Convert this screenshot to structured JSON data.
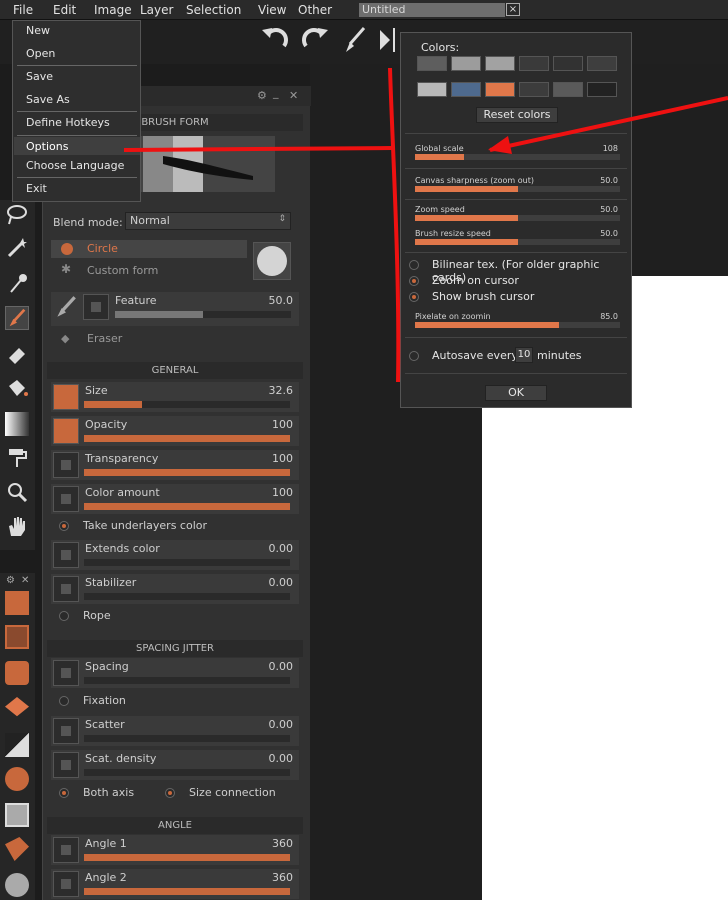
{
  "menubar": {
    "items": [
      "File",
      "Edit",
      "Image",
      "Layer",
      "Selection",
      "View",
      "Other"
    ],
    "document_title": "Untitled",
    "close_glyph": "×"
  },
  "file_menu": {
    "items": [
      "New",
      "Open",
      "Save",
      "Save As",
      "Define Hotkeys",
      "Options",
      "Choose Language",
      "Exit"
    ],
    "highlighted": "Options"
  },
  "brush_panel": {
    "brush_form_title": "BRUSH FORM",
    "blend_mode_label": "Blend mode:",
    "blend_mode_value": "Normal",
    "circle_label": "Circle",
    "custom_form_label": "Custom form",
    "feature": {
      "label": "Feature",
      "value": "50.0",
      "fraction": 0.5
    },
    "eraser_label": "Eraser",
    "general_title": "GENERAL",
    "general": [
      {
        "label": "Size",
        "value": "32.6",
        "fraction": 0.28
      },
      {
        "label": "Opacity",
        "value": "100",
        "fraction": 1.0
      },
      {
        "label": "Transparency",
        "value": "100",
        "fraction": 1.0
      },
      {
        "label": "Color amount",
        "value": "100",
        "fraction": 1.0
      }
    ],
    "take_underlayers": "Take underlayers color",
    "extends_color": {
      "label": "Extends color",
      "value": "0.00",
      "fraction": 0.0
    },
    "stabilizer": {
      "label": "Stabilizer",
      "value": "0.00",
      "fraction": 0.0
    },
    "rope_label": "Rope",
    "spacing_title": "SPACING JITTER",
    "spacing": {
      "label": "Spacing",
      "value": "0.00",
      "fraction": 0.0
    },
    "fixation_label": "Fixation",
    "scatter": {
      "label": "Scatter",
      "value": "0.00",
      "fraction": 0.0
    },
    "scat_density": {
      "label": "Scat. density",
      "value": "0.00",
      "fraction": 0.0
    },
    "both_axis_label": "Both axis",
    "size_connection_label": "Size connection",
    "angle_title": "ANGLE",
    "angle1": {
      "label": "Angle 1",
      "value": "360",
      "fraction": 1.0
    },
    "angle2": {
      "label": "Angle 2",
      "value": "360",
      "fraction": 1.0
    }
  },
  "options_dialog": {
    "colors_label": "Colors:",
    "swatch_colors_row1": [
      "#5e5e5e",
      "#9c9c9c",
      "#a2a2a2",
      "#3a3a3a",
      "#323232",
      "#3e3e3e"
    ],
    "swatch_colors_row2": [
      "#b8b8b8",
      "#4e6a8e",
      "#e0774a",
      "#3c3c3c",
      "#5a5a5a",
      "#222222"
    ],
    "reset_colors_label": "Reset colors",
    "sliders": [
      {
        "label": "Global scale",
        "value": "108",
        "fraction": 0.24
      },
      {
        "label": "Canvas sharpness (zoom out)",
        "value": "50.0",
        "fraction": 0.5
      },
      {
        "label": "Zoom speed",
        "value": "50.0",
        "fraction": 0.5
      },
      {
        "label": "Brush resize speed",
        "value": "50.0",
        "fraction": 0.5
      }
    ],
    "bilinear_label": "Bilinear tex. (For older graphic cards)",
    "zoom_cursor_label": "Zoom on cursor",
    "show_brush_label": "Show brush cursor",
    "pixelate": {
      "label": "Pixelate on zoomin",
      "value": "85.0",
      "fraction": 0.7
    },
    "autosave_label": "Autosave every",
    "autosave_value": "10",
    "minutes_label": "minutes",
    "ok_label": "OK"
  },
  "colors": {
    "accent": "#c8683c",
    "annotation_red": "#ee1111"
  }
}
